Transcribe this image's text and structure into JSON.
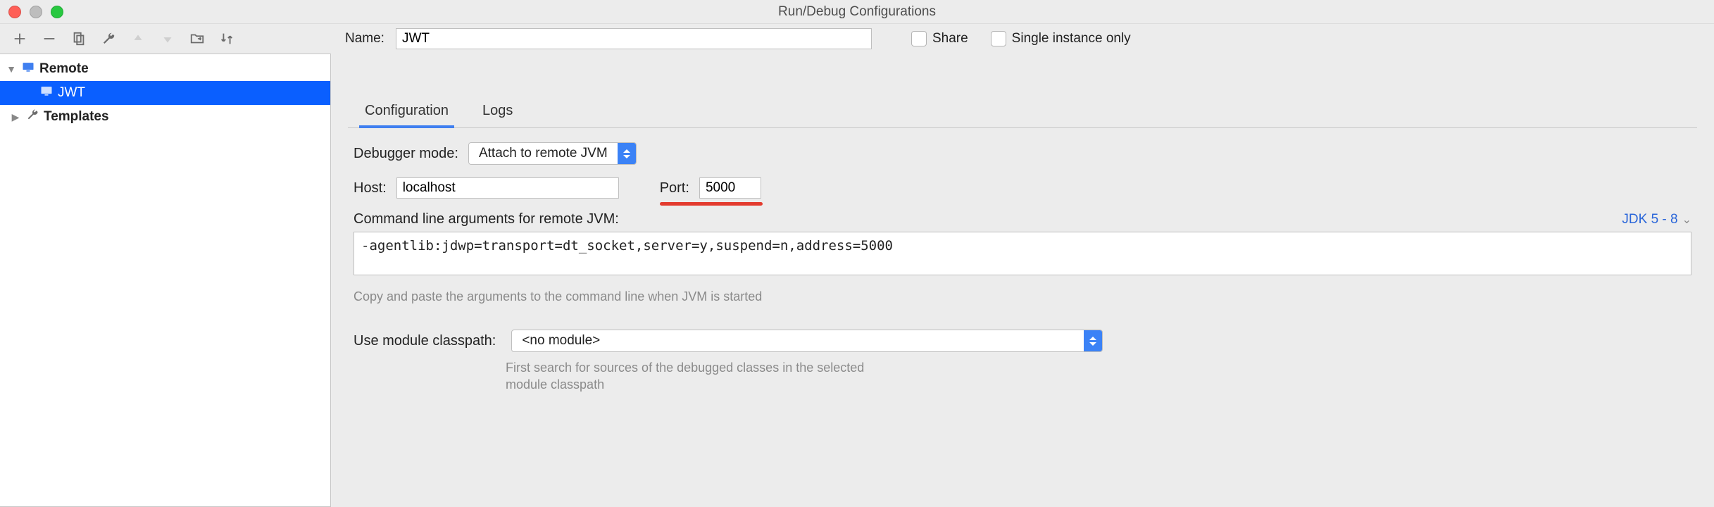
{
  "window": {
    "title": "Run/Debug Configurations"
  },
  "toolbar_icons": {
    "add": "add-icon",
    "remove": "remove-icon",
    "copy": "copy-icon",
    "edit": "wrench-icon",
    "up": "arrow-up-icon",
    "down": "arrow-down-icon",
    "folder_move": "folder-move-icon",
    "sort": "sort-icon"
  },
  "tree": {
    "root": {
      "label": "Remote",
      "expanded": true
    },
    "items": [
      {
        "label": "JWT",
        "selected": true
      }
    ],
    "templates": {
      "label": "Templates",
      "expanded": false
    }
  },
  "header": {
    "name_label": "Name:",
    "name_value": "JWT",
    "share_label": "Share",
    "share_checked": false,
    "single_instance_label": "Single instance only",
    "single_instance_checked": false
  },
  "tabs": {
    "items": [
      "Configuration",
      "Logs"
    ],
    "active_index": 0
  },
  "form": {
    "debugger_mode_label": "Debugger mode:",
    "debugger_mode_value": "Attach to remote JVM",
    "host_label": "Host:",
    "host_value": "localhost",
    "port_label": "Port:",
    "port_value": "5000",
    "cmd_label": "Command line arguments for remote JVM:",
    "jdk_link": "JDK 5 - 8",
    "cmd_value": "-agentlib:jdwp=transport=dt_socket,server=y,suspend=n,address=5000",
    "cmd_hint": "Copy and paste the arguments to the command line when JVM is started",
    "module_label": "Use module classpath:",
    "module_value": "<no module>",
    "module_hint": "First search for sources of the debugged classes in the selected module classpath"
  }
}
